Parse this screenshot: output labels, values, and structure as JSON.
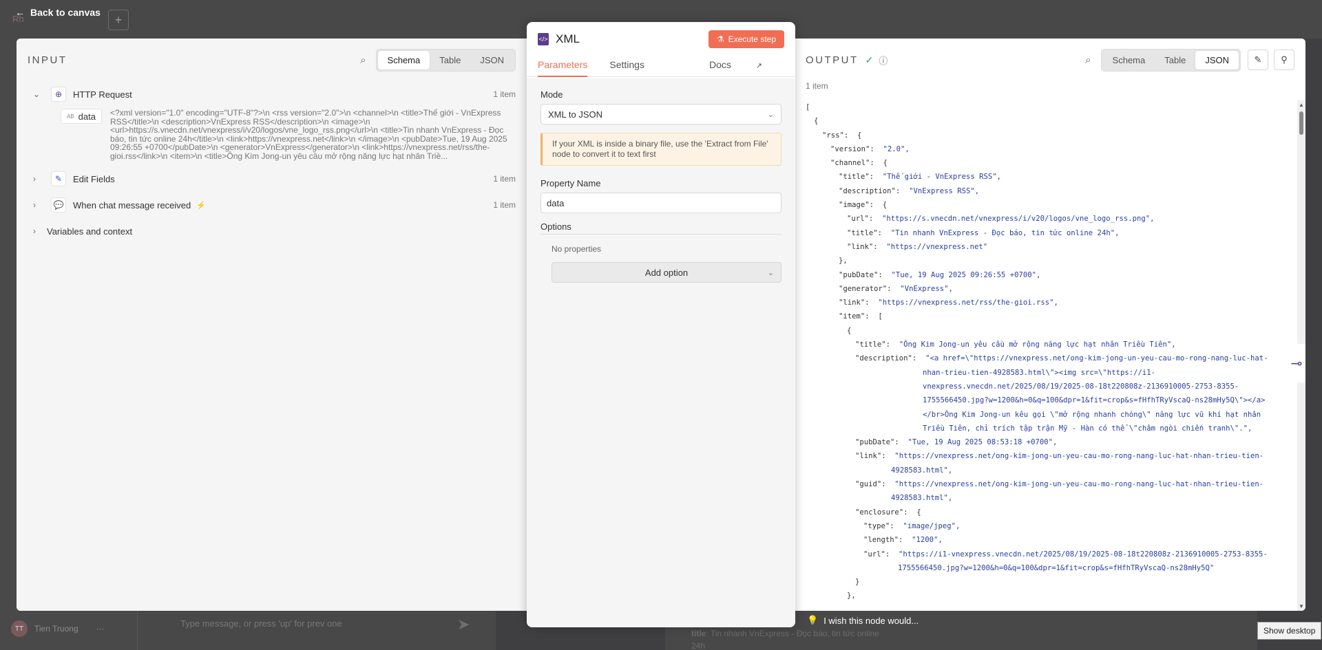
{
  "background": {
    "logo": "Rh",
    "back_label": "Back to canvas",
    "plus_label": "+",
    "user_initials": "TT",
    "user_name": "Tien Truong",
    "user_more": "···",
    "chat_placeholder": "Type message, or press 'up' for prev one",
    "right_text_key": "title",
    "right_text_value": ": Tin nhanh VnExpress - Đọc báo, tin tức online",
    "right_text_line2": "24h",
    "wish_label": "I wish this node would...",
    "show_desktop": "Show desktop"
  },
  "input": {
    "title": "INPUT",
    "view_tabs": [
      "Schema",
      "Table",
      "JSON"
    ],
    "active_tab": "Schema",
    "nodes": [
      {
        "name": "HTTP Request",
        "count": "1 item",
        "icon": "globe-icon"
      },
      {
        "name": "Edit Fields",
        "count": "1 item",
        "icon": "pencil-icon"
      },
      {
        "name": "When chat message received",
        "count": "1 item",
        "icon": "chat-icon",
        "badge": "⚡"
      }
    ],
    "data_key": "data",
    "data_type": "AB",
    "data_value": "<?xml version=\"1.0\" encoding=\"UTF-8\"?>\\n <rss version=\"2.0\">\\n <channel>\\n <title>Thế giới - VnExpress RSS</title>\\n <description>VnExpress RSS</description>\\n <image>\\n <url>https://s.vnecdn.net/vnexpress/i/v20/logos/vne_logo_rss.png</url>\\n <title>Tin nhanh VnExpress - Đọc báo, tin tức online 24h</title>\\n <link>https://vnexpress.net</link>\\n </image>\\n <pubDate>Tue, 19 Aug 2025 09:26:55 +0700</pubDate>\\n <generator>VnExpress</generator>\\n <link>https://vnexpress.net/rss/the-gioi.rss</link>\\n <item>\\n <title>Ông Kim Jong-un yêu cầu mở rộng năng lực hạt nhân Triề...",
    "vars_label": "Variables and context"
  },
  "center": {
    "title": "XML",
    "execute_label": "Execute step",
    "tabs": [
      "Parameters",
      "Settings"
    ],
    "docs_label": "Docs",
    "mode_label": "Mode",
    "mode_value": "XML to JSON",
    "notice": "If your XML is inside a binary file, use the 'Extract from File' node to convert it to text first",
    "property_label": "Property Name",
    "property_value": "data",
    "options_label": "Options",
    "no_props": "No properties",
    "add_option": "Add option"
  },
  "output": {
    "title": "OUTPUT",
    "view_tabs": [
      "Schema",
      "Table",
      "JSON"
    ],
    "active_tab": "JSON",
    "count": "1 item",
    "json_lines": [
      {
        "i": 0,
        "t": "["
      },
      {
        "i": 1,
        "t": "{"
      },
      {
        "i": 2,
        "k": "\"rss\"",
        "v": "{"
      },
      {
        "i": 3,
        "k": "\"version\"",
        "v": "\"2.0\","
      },
      {
        "i": 3,
        "k": "\"channel\"",
        "v": "{"
      },
      {
        "i": 4,
        "k": "\"title\"",
        "v": "\"Thế giới - VnExpress RSS\","
      },
      {
        "i": 4,
        "k": "\"description\"",
        "v": "\"VnExpress RSS\","
      },
      {
        "i": 4,
        "k": "\"image\"",
        "v": "{"
      },
      {
        "i": 5,
        "k": "\"url\"",
        "v": "\"https://s.vnecdn.net/vnexpress/i/v20/logos/vne_logo_rss.png\","
      },
      {
        "i": 5,
        "k": "\"title\"",
        "v": "\"Tin nhanh VnExpress - Đọc báo, tin tức online 24h\","
      },
      {
        "i": 5,
        "k": "\"link\"",
        "v": "\"https://vnexpress.net\""
      },
      {
        "i": 4,
        "t": "},"
      },
      {
        "i": 4,
        "k": "\"pubDate\"",
        "v": "\"Tue, 19 Aug 2025 09:26:55 +0700\","
      },
      {
        "i": 4,
        "k": "\"generator\"",
        "v": "\"VnExpress\","
      },
      {
        "i": 4,
        "k": "\"link\"",
        "v": "\"https://vnexpress.net/rss/the-gioi.rss\","
      },
      {
        "i": 4,
        "k": "\"item\"",
        "v": "["
      },
      {
        "i": 5,
        "t": "{"
      },
      {
        "i": 6,
        "k": "\"title\"",
        "v": "\"Ông Kim Jong-un yêu cầu mở rộng năng lực hạt nhân Triều Tiên\","
      },
      {
        "i": 6,
        "k": "\"description\"",
        "v": "\"<a href=\\\"https://vnexpress.net/ong-kim-jong-un-yeu-cau-mo-rong-nang-luc-hat-"
      },
      {
        "i": 6,
        "c": "nhan-trieu-tien-4928583.html\\\"><img src=\\\"https://i1-"
      },
      {
        "i": 6,
        "c": "vnexpress.vnecdn.net/2025/08/19/2025-08-18t220808z-2136910005-2753-8355-"
      },
      {
        "i": 6,
        "c": "1755566450.jpg?w=1200&h=0&q=100&dpr=1&fit=crop&s=fHfhTRyVscaQ-ns28mHy5Q\\\"></a>"
      },
      {
        "i": 6,
        "c": "</br>Ông Kim Jong-un kêu gọi \\\"mở rộng nhanh chóng\\\" năng lực vũ khí hạt nhân"
      },
      {
        "i": 6,
        "c": "Triều Tiên, chỉ trích tập trận Mỹ - Hàn có thể \\\"châm ngòi chiến tranh\\\".\","
      },
      {
        "i": 6,
        "k": "\"pubDate\"",
        "v": "\"Tue, 19 Aug 2025 08:53:18 +0700\","
      },
      {
        "i": 6,
        "k": "\"link\"",
        "v": "\"https://vnexpress.net/ong-kim-jong-un-yeu-cau-mo-rong-nang-luc-hat-nhan-trieu-tien-"
      },
      {
        "i": 6,
        "c2": "4928583.html\","
      },
      {
        "i": 6,
        "k": "\"guid\"",
        "v": "\"https://vnexpress.net/ong-kim-jong-un-yeu-cau-mo-rong-nang-luc-hat-nhan-trieu-tien-"
      },
      {
        "i": 6,
        "c2": "4928583.html\","
      },
      {
        "i": 6,
        "k": "\"enclosure\"",
        "v": "{"
      },
      {
        "i": 7,
        "k": "\"type\"",
        "v": "\"image/jpeg\","
      },
      {
        "i": 7,
        "k": "\"length\"",
        "v": "\"1200\","
      },
      {
        "i": 7,
        "k": "\"url\"",
        "v": "\"https://i1-vnexpress.vnecdn.net/2025/08/19/2025-08-18t220808z-2136910005-2753-8355-"
      },
      {
        "i": 7,
        "c3": "1755566450.jpg?w=1200&h=0&q=100&dpr=1&fit=crop&s=fHfhTRyVscaQ-ns28mHy5Q\""
      },
      {
        "i": 6,
        "t": "}"
      },
      {
        "i": 5,
        "t": "},"
      }
    ]
  },
  "colors": {
    "accent": "#ef6e54",
    "json_string": "#2a3ea2",
    "node_purple": "#5b3e8f"
  }
}
